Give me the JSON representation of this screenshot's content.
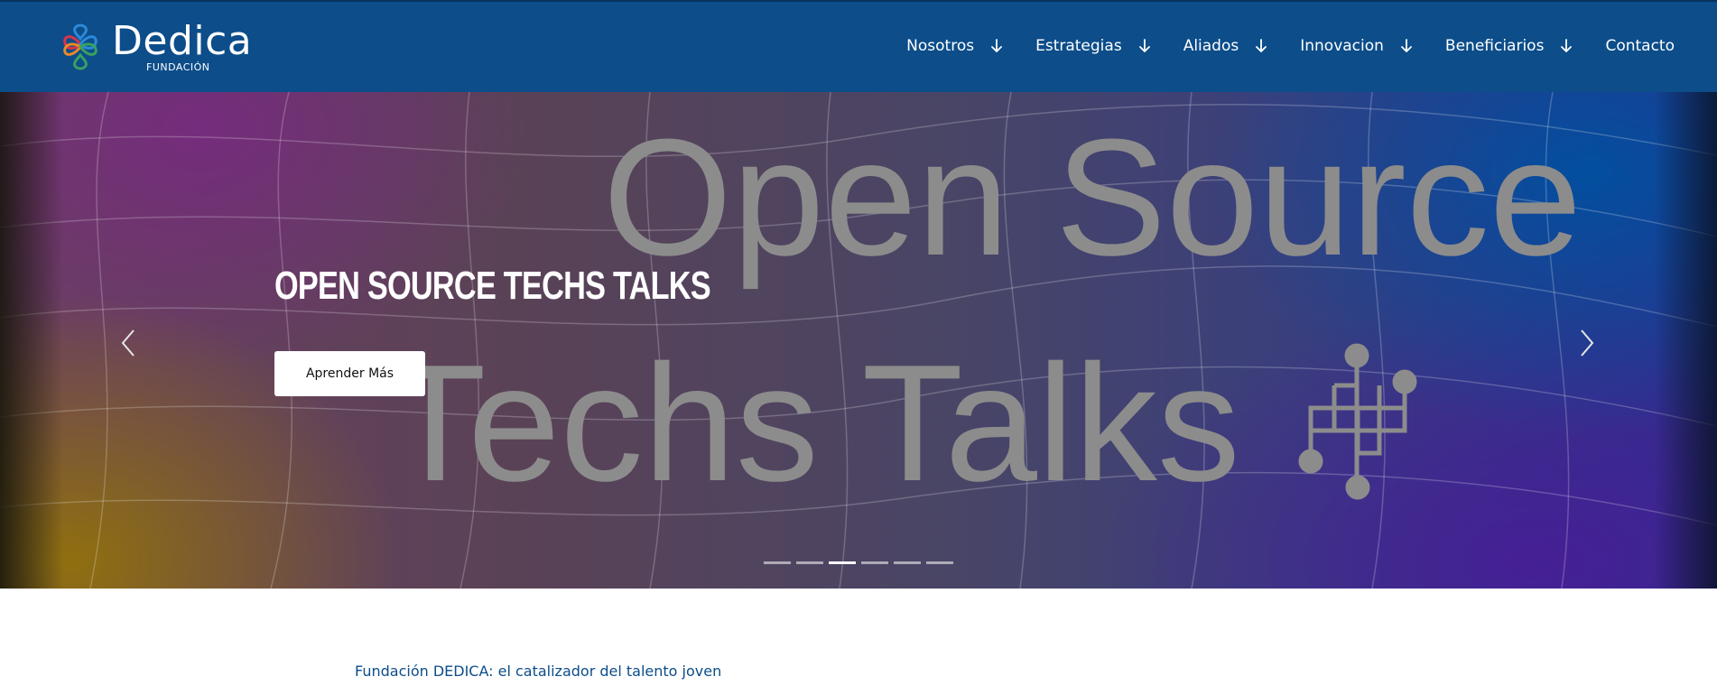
{
  "header": {
    "brand_name": "Dedica",
    "brand_sub": "FUNDACIÓN",
    "nav": [
      {
        "label": "Nosotros",
        "has_dropdown": true
      },
      {
        "label": "Estrategias",
        "has_dropdown": true
      },
      {
        "label": "Aliados",
        "has_dropdown": true
      },
      {
        "label": "Innovacion",
        "has_dropdown": true
      },
      {
        "label": "Beneficiarios",
        "has_dropdown": true
      },
      {
        "label": "Contacto",
        "has_dropdown": false
      }
    ]
  },
  "hero": {
    "background_text_line1": "Open Source",
    "background_text_line2": "Techs Talks",
    "title": "Open Source Techs Talks",
    "button_label": "Aprender Más",
    "slide_count": 6,
    "active_slide": 3,
    "prev_icon": "chevron-left-icon",
    "next_icon": "chevron-right-icon"
  },
  "intro": {
    "heading": "Fundación DEDICA: el catalizador del talento joven"
  },
  "colors": {
    "header_bg": "#0c4d8a",
    "accent_text": "#0c4d8a",
    "logo_blue": "#2a8ad8",
    "logo_red": "#d8344a",
    "logo_green": "#3aa060",
    "logo_orange": "#e88a2a"
  }
}
